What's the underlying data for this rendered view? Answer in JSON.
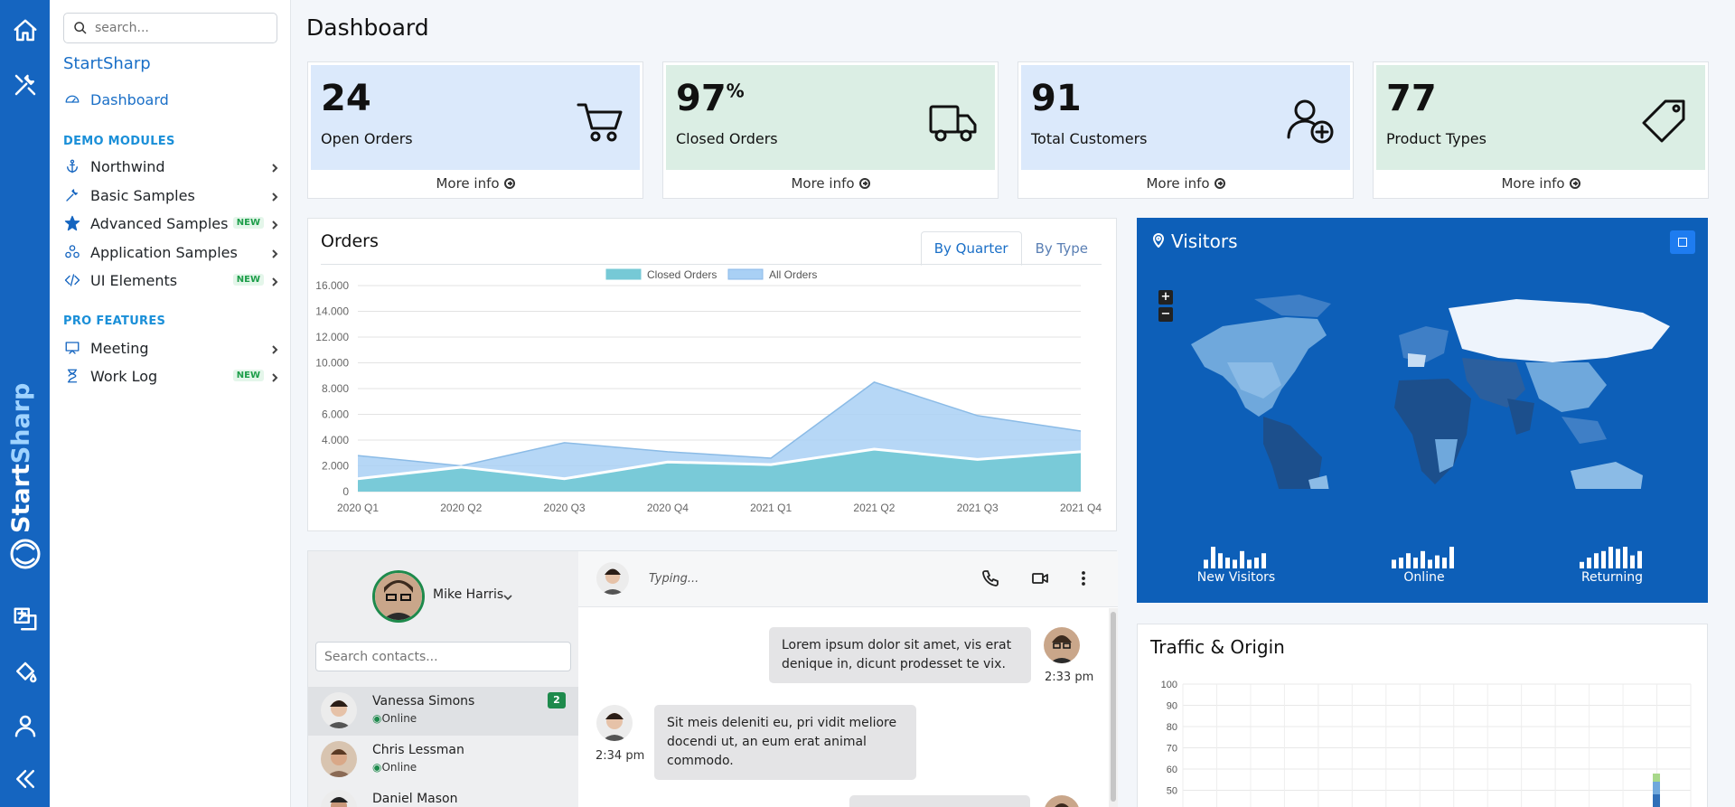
{
  "sidebar": {
    "search_placeholder": "search...",
    "app_name": "StartSharp",
    "dashboard": "Dashboard",
    "demo_title": "DEMO MODULES",
    "pro_title": "PRO FEATURES",
    "items": [
      {
        "label": "Northwind",
        "icon": "anchor-icon",
        "new": ""
      },
      {
        "label": "Basic Samples",
        "icon": "tools-icon",
        "new": ""
      },
      {
        "label": "Advanced Samples",
        "icon": "star-icon",
        "new": "NEW"
      },
      {
        "label": "Application Samples",
        "icon": "modules-icon",
        "new": ""
      },
      {
        "label": "UI Elements",
        "icon": "code-icon",
        "new": "NEW"
      },
      {
        "label": "Meeting",
        "icon": "meeting-icon",
        "new": ""
      },
      {
        "label": "Work Log",
        "icon": "hourglass-icon",
        "new": "NEW"
      }
    ]
  },
  "brand": {
    "start": "Start",
    "sharp": "Sharp"
  },
  "page": {
    "title": "Dashboard"
  },
  "stats": [
    {
      "value": "24",
      "suffix": "",
      "label": "Open Orders",
      "more": "More info",
      "bg": "#dbe9fb",
      "icon": "cart-icon"
    },
    {
      "value": "97",
      "suffix": "%",
      "label": "Closed Orders",
      "more": "More info",
      "bg": "#dbeee4",
      "icon": "truck-icon"
    },
    {
      "value": "91",
      "suffix": "",
      "label": "Total Customers",
      "more": "More info",
      "bg": "#dbe9fb",
      "icon": "user-plus-icon"
    },
    {
      "value": "77",
      "suffix": "",
      "label": "Product Types",
      "more": "More info",
      "bg": "#dbeee4",
      "icon": "tag-icon"
    }
  ],
  "orders": {
    "title": "Orders",
    "tab_quarter": "By Quarter",
    "tab_type": "By Type"
  },
  "chart_data": {
    "type": "area",
    "categories": [
      "2020 Q1",
      "2020 Q2",
      "2020 Q3",
      "2020 Q4",
      "2021 Q1",
      "2021 Q2",
      "2021 Q3",
      "2021 Q4"
    ],
    "series": [
      {
        "name": "Closed Orders",
        "values": [
          1000,
          1900,
          1000,
          2300,
          2100,
          3300,
          2500,
          3100
        ],
        "color": "#76c9d6"
      },
      {
        "name": "All Orders",
        "values": [
          2800,
          2000,
          3800,
          3100,
          2600,
          8500,
          5900,
          4700
        ],
        "color": "#a9d0f5"
      }
    ],
    "yticks": [
      "16.000",
      "14.000",
      "12.000",
      "10.000",
      "8.000",
      "6.000",
      "4.000",
      "2.000",
      "0"
    ],
    "ylim": [
      0,
      16000
    ],
    "legend": "top",
    "grid": true
  },
  "visitors": {
    "title": "Visitors",
    "sparks": [
      {
        "label": "New Visitors",
        "values": [
          8,
          20,
          14,
          10,
          8,
          16,
          8,
          10,
          14
        ]
      },
      {
        "label": "Online",
        "values": [
          8,
          10,
          14,
          10,
          16,
          8,
          12,
          10,
          20
        ]
      },
      {
        "label": "Returning",
        "values": [
          6,
          10,
          14,
          16,
          20,
          18,
          20,
          12,
          16
        ]
      }
    ]
  },
  "chat": {
    "user": "Mike Harris",
    "contact_search_placeholder": "Search contacts...",
    "typing": "Typing...",
    "contacts": [
      {
        "name": "Vanessa Simons",
        "status": "Online",
        "badge": "2"
      },
      {
        "name": "Chris Lessman",
        "status": "Online",
        "badge": ""
      },
      {
        "name": "Daniel Mason",
        "status": "",
        "badge": ""
      }
    ],
    "messages": [
      {
        "text": "Lorem ipsum dolor sit amet, vis erat denique in, dicunt prodesset te vix.",
        "time": "2:33 pm"
      },
      {
        "text": "Sit meis deleniti eu, pri vidit meliore docendi ut, an eum erat animal commodo.",
        "time": "2:34 pm"
      }
    ]
  },
  "traffic": {
    "title": "Traffic & Origin",
    "yticks": [
      "100",
      "90",
      "80",
      "70",
      "60",
      "50"
    ]
  }
}
